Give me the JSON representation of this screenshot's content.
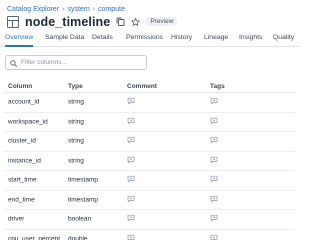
{
  "breadcrumb": [
    "Catalog Explorer",
    "system",
    "compute"
  ],
  "breadcrumb_separator": "›",
  "title": "node_timeline",
  "badge": "Preview",
  "tabs": [
    {
      "label": "Overview",
      "active": true
    },
    {
      "label": "Sample Data",
      "active": false
    },
    {
      "label": "Details",
      "active": false
    },
    {
      "label": "Permissions",
      "active": false
    },
    {
      "label": "History",
      "active": false
    },
    {
      "label": "Lineage",
      "active": false
    },
    {
      "label": "Insights",
      "active": false
    },
    {
      "label": "Quality",
      "active": false
    }
  ],
  "filter": {
    "placeholder": "Filter columns..."
  },
  "table": {
    "headers": [
      "Column",
      "Type",
      "Comment",
      "Tags"
    ],
    "rows": [
      {
        "name": "account_id",
        "type": "string"
      },
      {
        "name": "workspace_id",
        "type": "string"
      },
      {
        "name": "cluster_id",
        "type": "string"
      },
      {
        "name": "instance_id",
        "type": "string"
      },
      {
        "name": "start_time",
        "type": "timestamp"
      },
      {
        "name": "end_time",
        "type": "timestamp"
      },
      {
        "name": "driver",
        "type": "boolean"
      },
      {
        "name": "cpu_user_percent",
        "type": "double"
      }
    ]
  },
  "icons": {
    "table": "table-icon",
    "copy": "copy-icon",
    "favorite": "star-icon",
    "search": "search-icon",
    "comment": "comment-icon",
    "tag": "tag-icon"
  },
  "colors": {
    "accent": "#2f72c4",
    "text": "#1b2a3a",
    "icon": "#8a95a2"
  }
}
